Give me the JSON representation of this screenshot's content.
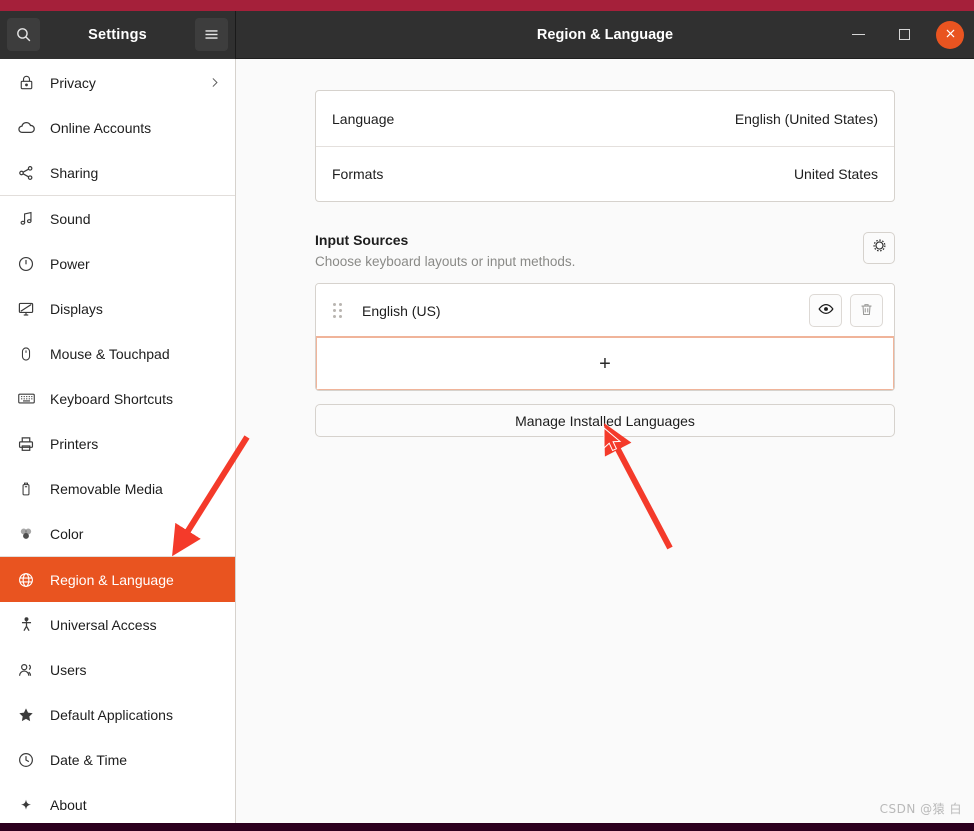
{
  "window": {
    "sidebar_title": "Settings",
    "title": "Region & Language",
    "search_icon": "search-icon",
    "menu_icon": "hamburger-menu-icon",
    "minimize_label": "Minimize",
    "maximize_label": "Maximize",
    "close_label": "Close"
  },
  "sidebar": {
    "items": [
      {
        "label": "Privacy",
        "icon": "lock-icon",
        "selected": false,
        "chevron": true
      },
      {
        "label": "Online Accounts",
        "icon": "cloud-icon",
        "selected": false,
        "chevron": false
      },
      {
        "label": "Sharing",
        "icon": "share-nodes-icon",
        "selected": false,
        "chevron": false
      },
      {
        "label": "Sound",
        "icon": "music-note-icon",
        "selected": false,
        "chevron": false,
        "divider_before": true
      },
      {
        "label": "Power",
        "icon": "power-icon",
        "selected": false,
        "chevron": false
      },
      {
        "label": "Displays",
        "icon": "monitor-icon",
        "selected": false,
        "chevron": false
      },
      {
        "label": "Mouse & Touchpad",
        "icon": "mouse-icon",
        "selected": false,
        "chevron": false
      },
      {
        "label": "Keyboard Shortcuts",
        "icon": "keyboard-icon",
        "selected": false,
        "chevron": false
      },
      {
        "label": "Printers",
        "icon": "printer-icon",
        "selected": false,
        "chevron": false
      },
      {
        "label": "Removable Media",
        "icon": "usb-drive-icon",
        "selected": false,
        "chevron": false
      },
      {
        "label": "Color",
        "icon": "color-circles-icon",
        "selected": false,
        "chevron": false
      },
      {
        "label": "Region & Language",
        "icon": "globe-icon",
        "selected": true,
        "chevron": false,
        "divider_before": true
      },
      {
        "label": "Universal Access",
        "icon": "accessibility-person-icon",
        "selected": false,
        "chevron": false
      },
      {
        "label": "Users",
        "icon": "users-icon",
        "selected": false,
        "chevron": false
      },
      {
        "label": "Default Applications",
        "icon": "star-icon",
        "selected": false,
        "chevron": false
      },
      {
        "label": "Date & Time",
        "icon": "clock-icon",
        "selected": false,
        "chevron": false
      },
      {
        "label": "About",
        "icon": "sparkle-icon",
        "selected": false,
        "chevron": false
      }
    ]
  },
  "main": {
    "settings_rows": [
      {
        "label": "Language",
        "value": "English (United States)"
      },
      {
        "label": "Formats",
        "value": "United States"
      }
    ],
    "input_sources": {
      "title": "Input Sources",
      "subtitle": "Choose keyboard layouts or input methods.",
      "options_icon": "gear-options-icon",
      "entries": [
        {
          "name": "English (US)",
          "preview_icon": "eye-icon",
          "remove_icon": "trash-icon",
          "grip_icon": "drag-handle-icon"
        }
      ],
      "add_label": "+",
      "add_icon": "plus-icon"
    },
    "manage_button": "Manage Installed Languages"
  },
  "annotations": {
    "arrow_to_sidebar": "red-arrow-pointing-to-region-and-language",
    "arrow_to_manage": "red-arrow-pointing-to-manage-installed-languages",
    "cursor": "mouse-cursor-arrow"
  },
  "watermark": "CSDN @猿 白",
  "colors": {
    "accent": "#e95420",
    "titlebar": "#303030",
    "desktop_top": "#a5203a",
    "desktop_bottom": "#2c001e",
    "annotation_red": "#f43a2a",
    "focus_border": "#f0b49a"
  }
}
